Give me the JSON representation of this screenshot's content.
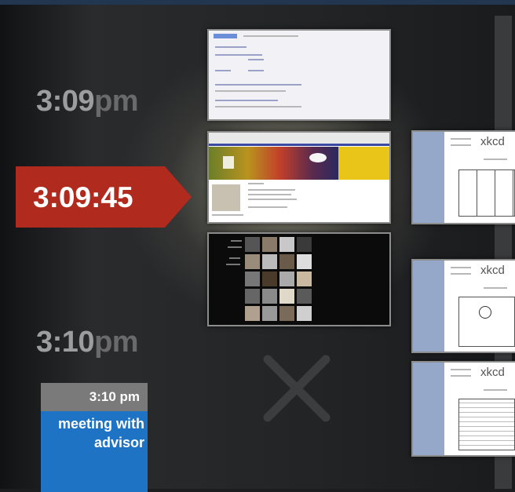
{
  "timeline": {
    "label_top": {
      "time": "3:09",
      "suffix": "pm"
    },
    "current": "3:09:45",
    "label_bottom": {
      "time": "3:10",
      "suffix": "pm"
    }
  },
  "xkcd": {
    "title": "xkcd"
  },
  "event": {
    "time": "3:10 pm",
    "title_line1": "meeting with",
    "title_line2": "advisor"
  },
  "colors": {
    "accent": "#b02a1e",
    "event_blue": "#1f73c4"
  },
  "icons": {
    "close": "x-icon"
  }
}
